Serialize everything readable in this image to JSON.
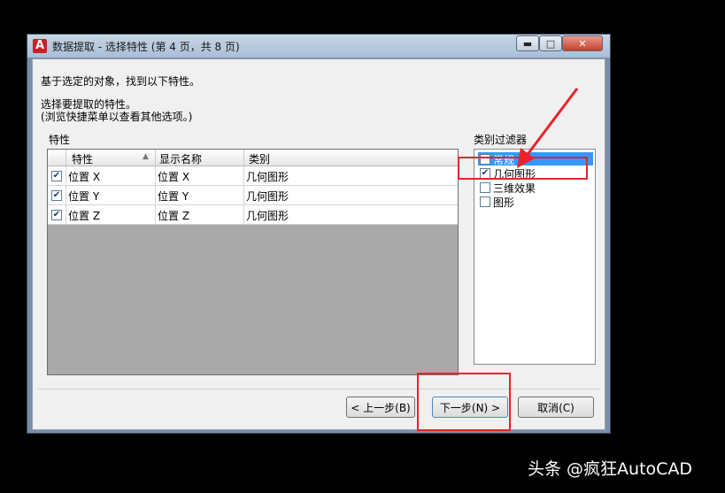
{
  "window": {
    "title": "数据提取 - 选择特性 (第 4 页，共 8 页)",
    "app_icon_letter": "A",
    "min_label": "▬",
    "max_label": "□",
    "close_label": "✕"
  },
  "intro": {
    "line1": "基于选定的对象，找到以下特性。",
    "line2": "选择要提取的特性。",
    "line3": "(浏览快捷菜单以查看其他选项。)"
  },
  "properties": {
    "group_label": "特性",
    "columns": [
      "特性",
      "显示名称",
      "类别"
    ],
    "rows": [
      {
        "checked": true,
        "property": "位置 X",
        "display_name": "位置 X",
        "category": "几何图形"
      },
      {
        "checked": true,
        "property": "位置 Y",
        "display_name": "位置 Y",
        "category": "几何图形"
      },
      {
        "checked": true,
        "property": "位置 Z",
        "display_name": "位置 Z",
        "category": "几何图形"
      }
    ]
  },
  "category_filter": {
    "group_label": "类别过滤器",
    "items": [
      {
        "label": "常规",
        "checked": false,
        "selected": true
      },
      {
        "label": "几何图形",
        "checked": true,
        "selected": false
      },
      {
        "label": "三维效果",
        "checked": false,
        "selected": false
      },
      {
        "label": "图形",
        "checked": false,
        "selected": false
      }
    ]
  },
  "buttons": {
    "back": "< 上一步(B)",
    "next": "下一步(N) >",
    "cancel": "取消(C)"
  },
  "watermark": "头条 @疯狂AutoCAD",
  "colors": {
    "highlight_red": "#e8232a",
    "selection_blue": "#3399ff"
  }
}
